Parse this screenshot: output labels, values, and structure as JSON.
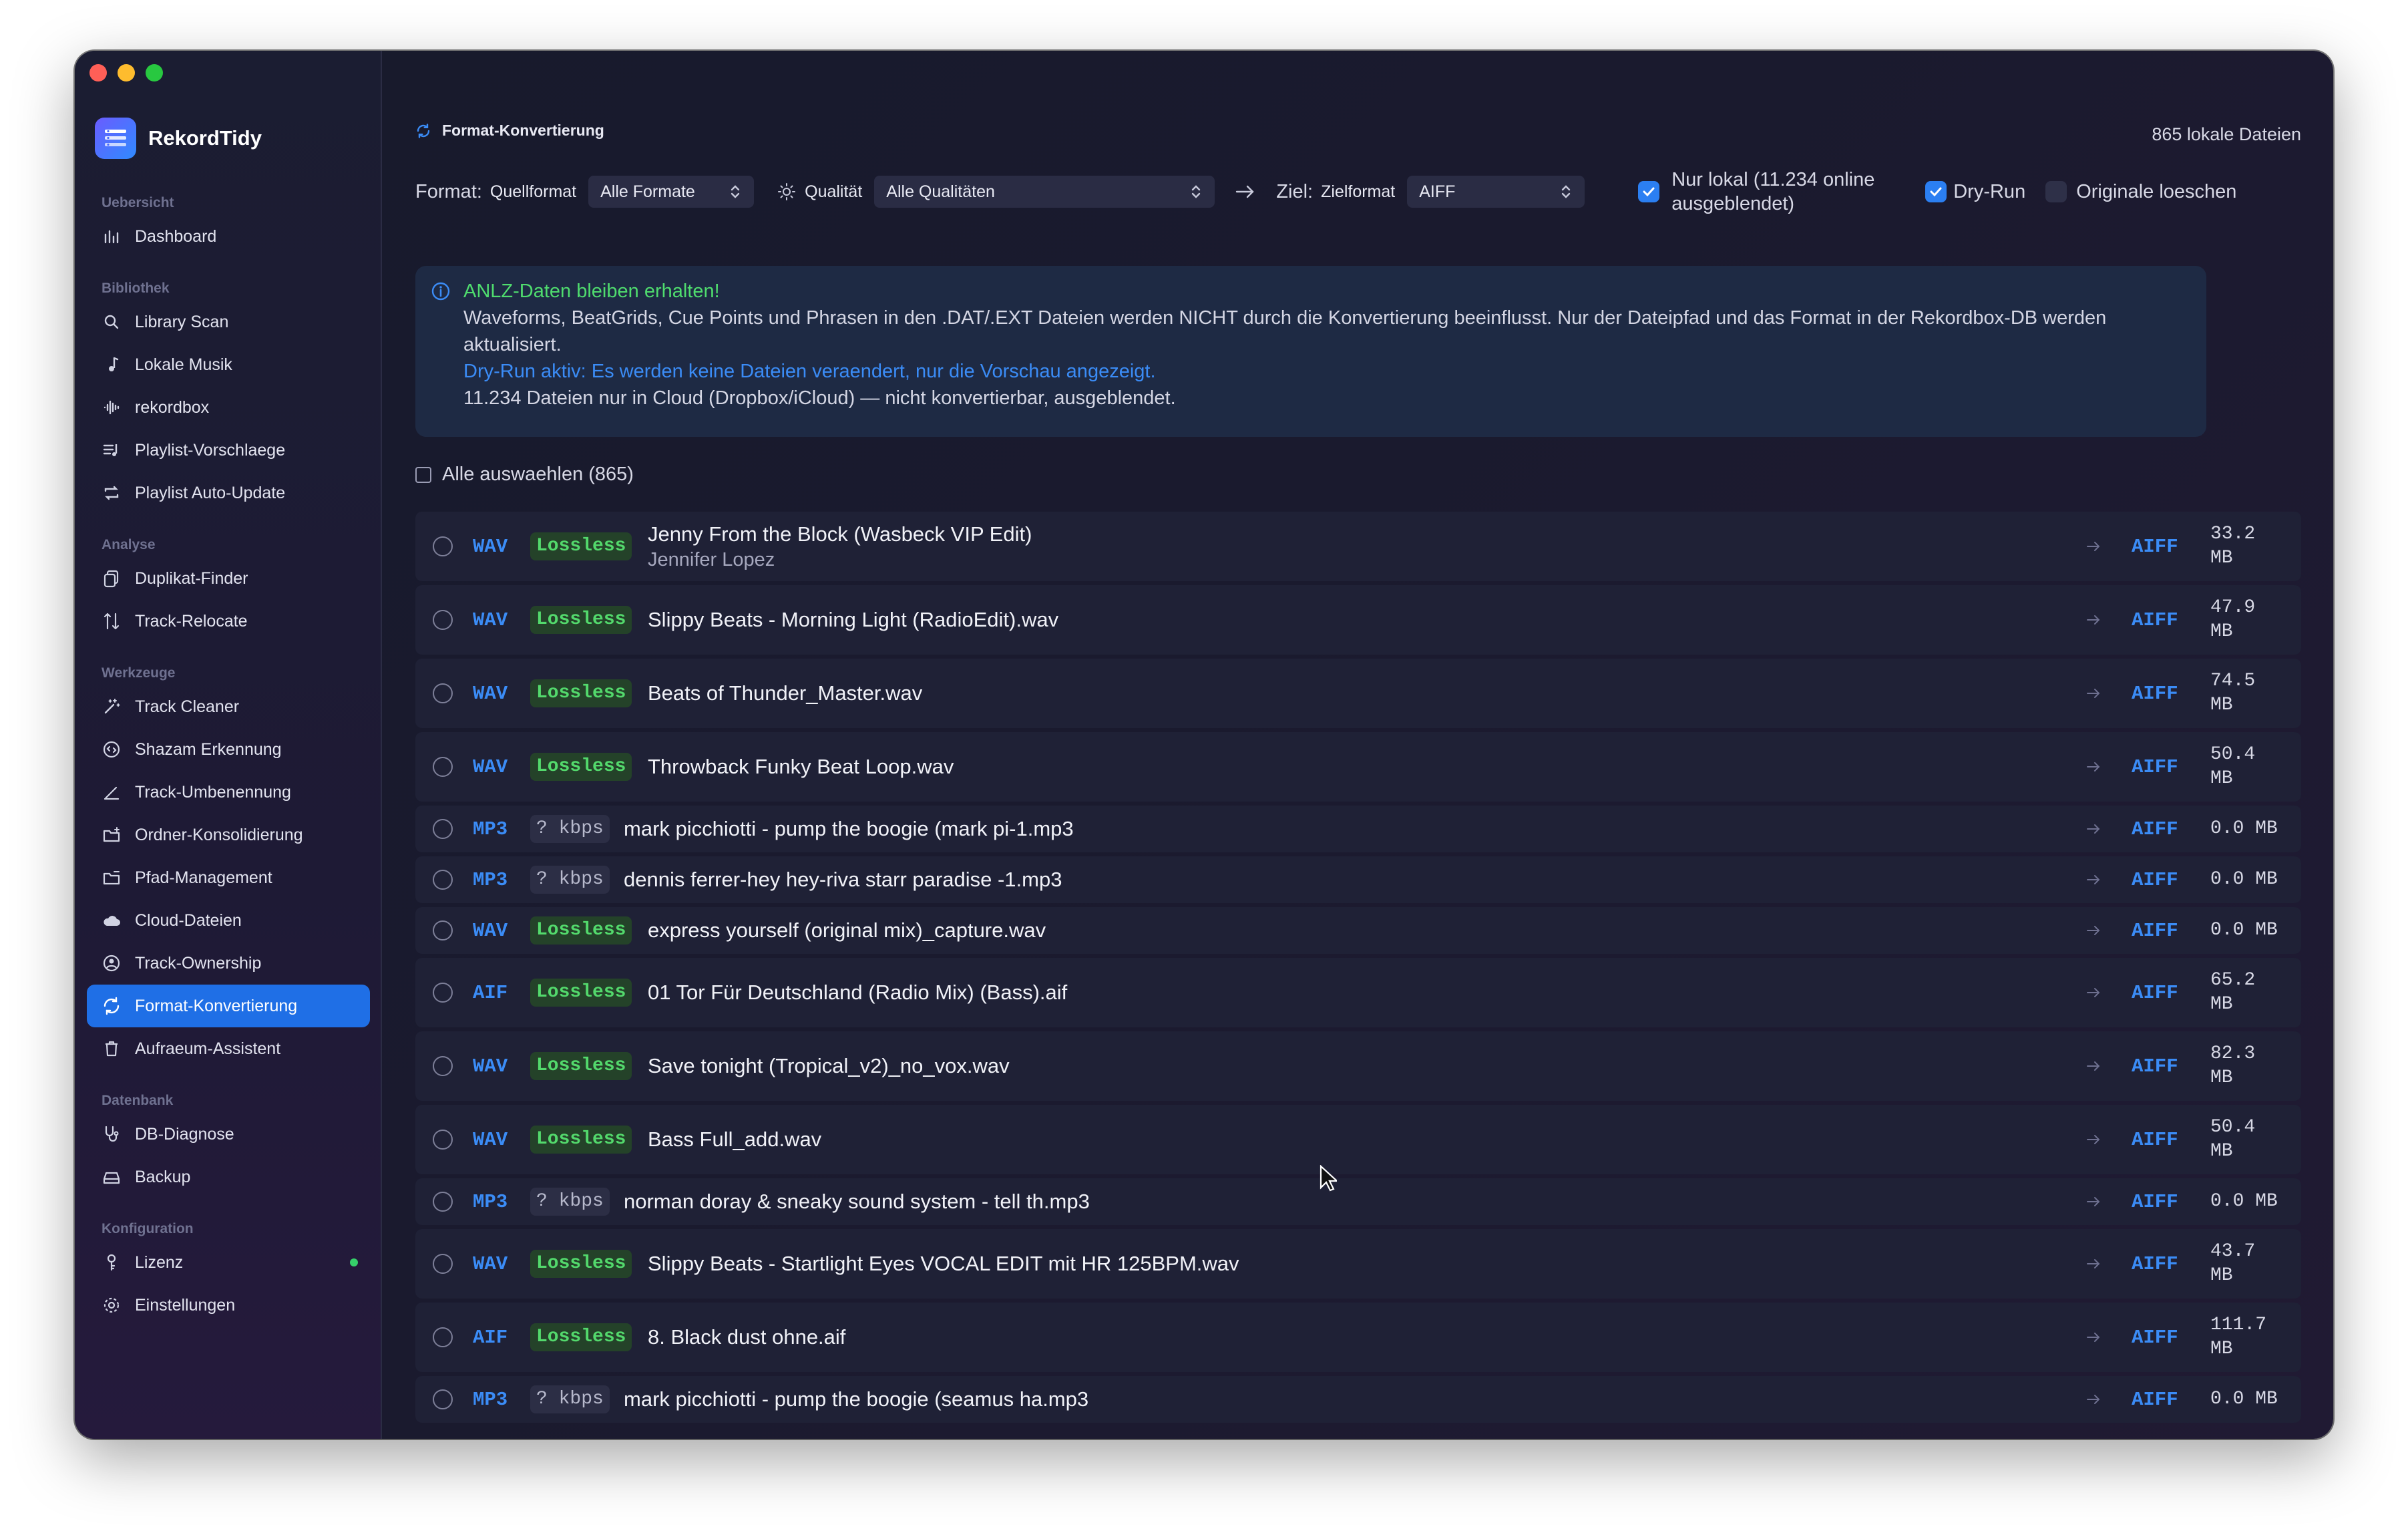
{
  "app": {
    "name": "RekordTidy"
  },
  "sidebar": {
    "sections": [
      {
        "title": "Uebersicht",
        "items": [
          {
            "label": "Dashboard",
            "icon": "chart-icon"
          }
        ]
      },
      {
        "title": "Bibliothek",
        "items": [
          {
            "label": "Library Scan",
            "icon": "search-icon"
          },
          {
            "label": "Lokale Musik",
            "icon": "music-note-icon"
          },
          {
            "label": "rekordbox",
            "icon": "waveform-icon"
          },
          {
            "label": "Playlist-Vorschlaege",
            "icon": "playlist-icon"
          },
          {
            "label": "Playlist Auto-Update",
            "icon": "repeat-icon"
          }
        ]
      },
      {
        "title": "Analyse",
        "items": [
          {
            "label": "Duplikat-Finder",
            "icon": "duplicate-icon"
          },
          {
            "label": "Track-Relocate",
            "icon": "relocate-icon"
          }
        ]
      },
      {
        "title": "Werkzeuge",
        "items": [
          {
            "label": "Track Cleaner",
            "icon": "wand-icon"
          },
          {
            "label": "Shazam Erkennung",
            "icon": "shazam-icon"
          },
          {
            "label": "Track-Umbenennung",
            "icon": "pencil-icon"
          },
          {
            "label": "Ordner-Konsolidierung",
            "icon": "folder-icon"
          },
          {
            "label": "Pfad-Management",
            "icon": "folder-path-icon"
          },
          {
            "label": "Cloud-Dateien",
            "icon": "cloud-icon"
          },
          {
            "label": "Track-Ownership",
            "icon": "ownership-icon"
          },
          {
            "label": "Format-Konvertierung",
            "icon": "convert-icon"
          },
          {
            "label": "Aufraeum-Assistent",
            "icon": "trash-icon"
          }
        ]
      },
      {
        "title": "Datenbank",
        "items": [
          {
            "label": "DB-Diagnose",
            "icon": "stethoscope-icon"
          },
          {
            "label": "Backup",
            "icon": "backup-icon"
          }
        ]
      },
      {
        "title": "Konfiguration",
        "items": [
          {
            "label": "Lizenz",
            "icon": "key-icon"
          },
          {
            "label": "Einstellungen",
            "icon": "gear-icon"
          }
        ]
      }
    ],
    "active": "Format-Konvertierung",
    "license_status_color": "#36d06a"
  },
  "header": {
    "title": "Format-Konvertierung",
    "file_count": "865 lokale Dateien"
  },
  "toolbar": {
    "format_label": "Format:",
    "source_label": "Quellformat",
    "source_value": "Alle Formate",
    "quality_label": "Qualität",
    "quality_value": "Alle Qualitäten",
    "target_prefix": "Ziel:",
    "target_label": "Zielformat",
    "target_value": "AIFF",
    "local_only_label": "Nur lokal (11.234 online ausgeblendet)",
    "local_only_checked": true,
    "dryrun_label": "Dry-Run",
    "dryrun_checked": true,
    "delete_label": "Originale loeschen",
    "delete_checked": false
  },
  "info": {
    "title": "ANLZ-Daten bleiben erhalten!",
    "body": "Waveforms, BeatGrids, Cue Points und Phrasen in den .DAT/.EXT Dateien werden NICHT durch die Konvertierung beeinflusst. Nur der Dateipfad und das Format in der Rekordbox-DB werden aktualisiert.",
    "dryrun": "Dry-Run aktiv: Es werden keine Dateien veraendert, nur die Vorschau angezeigt.",
    "cloud": "11.234 Dateien nur in Cloud (Dropbox/iCloud) — nicht konvertierbar, ausgeblendet."
  },
  "select_all": "Alle auswaehlen (865)",
  "tracks": [
    {
      "format": "WAV",
      "quality": "Lossless",
      "title": "Jenny From the Block (Wasbeck VIP Edit)",
      "artist": "Jennifer Lopez",
      "target": "AIFF",
      "size": "33.2\nMB"
    },
    {
      "format": "WAV",
      "quality": "Lossless",
      "title": "Slippy Beats - Morning Light (RadioEdit).wav",
      "artist": "",
      "target": "AIFF",
      "size": "47.9\nMB"
    },
    {
      "format": "WAV",
      "quality": "Lossless",
      "title": "Beats of Thunder_Master.wav",
      "artist": "",
      "target": "AIFF",
      "size": "74.5\nMB"
    },
    {
      "format": "WAV",
      "quality": "Lossless",
      "title": "Throwback Funky Beat Loop.wav",
      "artist": "",
      "target": "AIFF",
      "size": "50.4\nMB"
    },
    {
      "format": "MP3",
      "quality": "? kbps",
      "title": "mark picchiotti - pump the boogie (mark pi-1.mp3",
      "artist": "",
      "target": "AIFF",
      "size": "0.0 MB"
    },
    {
      "format": "MP3",
      "quality": "? kbps",
      "title": "dennis ferrer-hey hey-riva starr paradise -1.mp3",
      "artist": "",
      "target": "AIFF",
      "size": "0.0 MB"
    },
    {
      "format": "WAV",
      "quality": "Lossless",
      "title": "express yourself (original mix)_capture.wav",
      "artist": "",
      "target": "AIFF",
      "size": "0.0 MB"
    },
    {
      "format": "AIF",
      "quality": "Lossless",
      "title": "01 Tor Für Deutschland (Radio Mix) (Bass).aif",
      "artist": "",
      "target": "AIFF",
      "size": "65.2\nMB"
    },
    {
      "format": "WAV",
      "quality": "Lossless",
      "title": "Save tonight (Tropical_v2)_no_vox.wav",
      "artist": "",
      "target": "AIFF",
      "size": "82.3\nMB"
    },
    {
      "format": "WAV",
      "quality": "Lossless",
      "title": "Bass Full_add.wav",
      "artist": "",
      "target": "AIFF",
      "size": "50.4\nMB"
    },
    {
      "format": "MP3",
      "quality": "? kbps",
      "title": "norman doray & sneaky sound system - tell th.mp3",
      "artist": "",
      "target": "AIFF",
      "size": "0.0 MB"
    },
    {
      "format": "WAV",
      "quality": "Lossless",
      "title": "Slippy Beats - Startlight Eyes VOCAL EDIT mit HR 125BPM.wav",
      "artist": "",
      "target": "AIFF",
      "size": "43.7\nMB"
    },
    {
      "format": "AIF",
      "quality": "Lossless",
      "title": "8. Black dust ohne.aif",
      "artist": "",
      "target": "AIFF",
      "size": "111.7\nMB"
    },
    {
      "format": "MP3",
      "quality": "? kbps",
      "title": "mark picchiotti - pump the boogie (seamus ha.mp3",
      "artist": "",
      "target": "AIFF",
      "size": "0.0 MB"
    }
  ]
}
